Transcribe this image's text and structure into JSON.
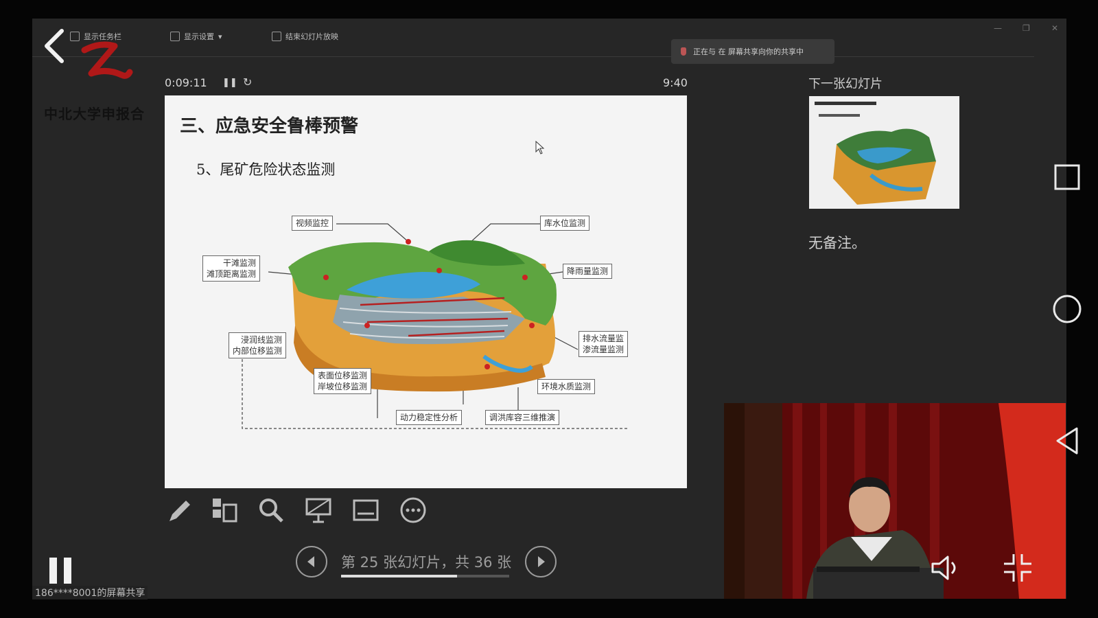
{
  "toolbar": {
    "item1": "显示任务栏",
    "item2": "显示设置",
    "item3": "结束幻灯片放映"
  },
  "notification": {
    "text": "正在与 在 屏幕共享向你的共享中"
  },
  "org": {
    "name": "中北大学申报合"
  },
  "presenter": {
    "elapsed": "0:09:11",
    "clock": "9:40",
    "next_label": "下一张幻灯片",
    "notes": "无备注。",
    "slide_counter": "第 25 张幻灯片，共 36 张",
    "progress": 0.69,
    "share_text": "186****8001的屏幕共享"
  },
  "slide": {
    "title": "三、应急安全鲁棒预警",
    "subtitle": "5、尾矿危险状态监测",
    "labels": {
      "video": "视频监控",
      "water_level": "库水位监测",
      "dry_beach_1": "干滩监测",
      "dry_beach_2": "滩顶距离监测",
      "rainfall": "降雨量监测",
      "seepage_1": "浸润线监测",
      "seepage_2": "内部位移监测",
      "drain_1": "排水流量监",
      "drain_2": "渗流量监测",
      "surface_1": "表面位移监测",
      "surface_2": "岸坡位移监测",
      "env_water": "环境水质监测",
      "dynamic": "动力稳定性分析",
      "flood": "调洪库容三维推演"
    }
  },
  "colors": {
    "window_bg": "#262626",
    "slide_bg": "#f4f4f4",
    "accent": "#dedede"
  }
}
